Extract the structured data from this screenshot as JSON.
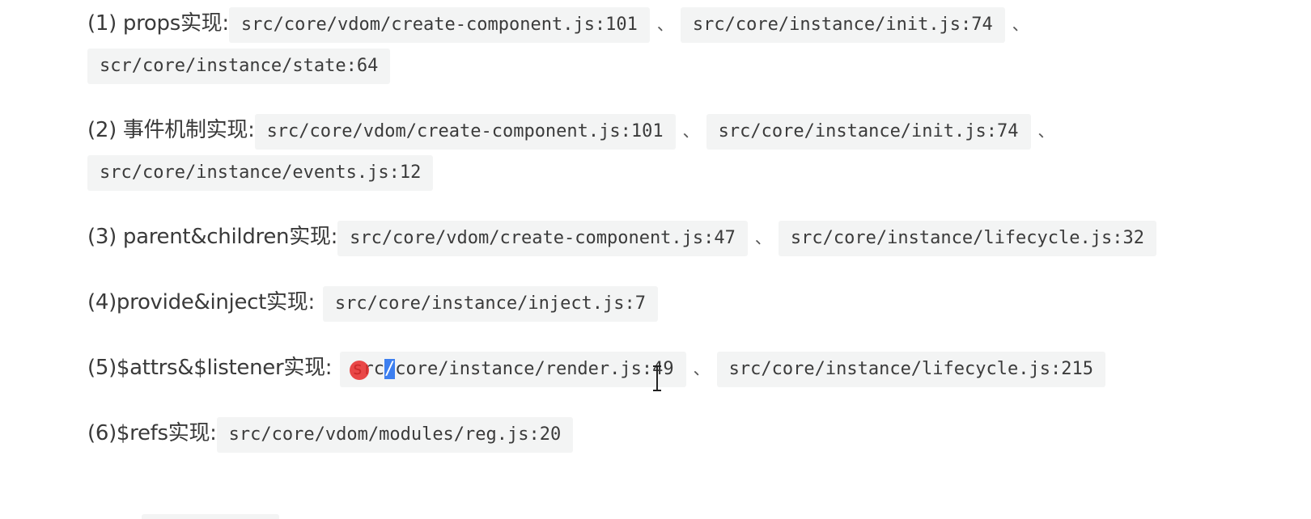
{
  "separator": "、",
  "items": [
    {
      "label": "(1) props实现:",
      "codes": [
        "src/core/vdom/create-component.js:101",
        "src/core/instance/init.js:74",
        "scr/core/instance/state:64"
      ]
    },
    {
      "label": "(2) 事件机制实现:",
      "codes": [
        "src/core/vdom/create-component.js:101",
        "src/core/instance/init.js:74",
        "src/core/instance/events.js:12"
      ]
    },
    {
      "label": "(3) parent&children实现:",
      "codes": [
        "src/core/vdom/create-component.js:47",
        "src/core/instance/lifecycle.js:32"
      ]
    },
    {
      "label": "(4)provide&inject实现:",
      "codes": [
        "src/core/instance/inject.js:7"
      ]
    },
    {
      "label": "(5)$attrs&$listener实现:",
      "codes_first_parts": [
        "sr",
        "c",
        "/",
        "core/instance/render.js:49"
      ],
      "codes": [
        "src/core/instance/render.js:49",
        "src/core/instance/lifecycle.js:215"
      ]
    },
    {
      "label": "(6)$refs实现:",
      "codes": [
        "src/core/vdom/modules/reg.js:20"
      ]
    }
  ]
}
